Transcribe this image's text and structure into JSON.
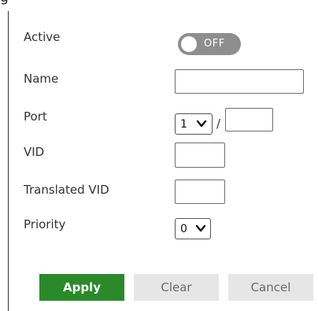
{
  "header_fragment": "g",
  "form": {
    "active": {
      "label": "Active",
      "toggle_text": "OFF",
      "state": "off"
    },
    "name": {
      "label": "Name",
      "value": ""
    },
    "port": {
      "label": "Port",
      "slot_value": "1",
      "separator": "/",
      "port_value": ""
    },
    "vid": {
      "label": "VID",
      "value": ""
    },
    "translated_vid": {
      "label": "Translated VID",
      "value": ""
    },
    "priority": {
      "label": "Priority",
      "value": "0"
    }
  },
  "actions": {
    "apply_label": "Apply",
    "clear_label": "Clear",
    "cancel_label": "Cancel"
  },
  "colors": {
    "apply_button": "#2a8a2a",
    "secondary_button": "#e6e6e6",
    "toggle_off": "#8e8e8e",
    "text": "#333333"
  },
  "icons": {
    "select_chevron": "chevron-down-icon"
  }
}
